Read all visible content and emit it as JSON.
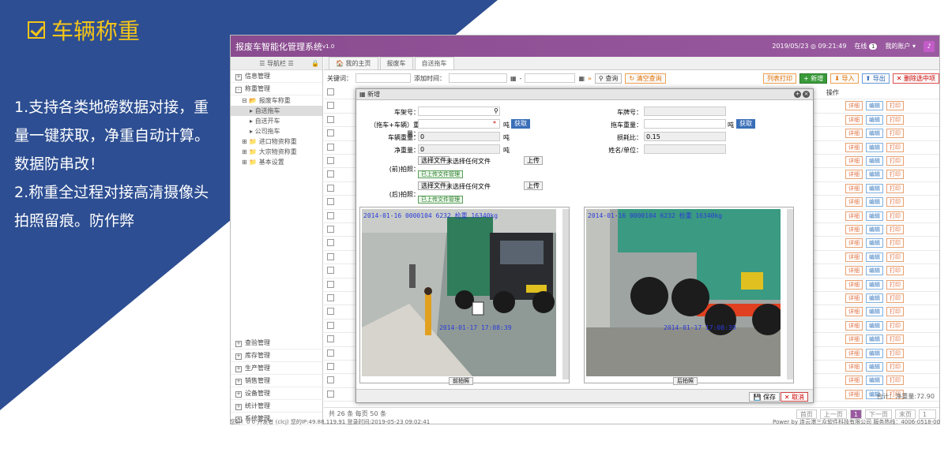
{
  "slide": {
    "title": "车辆称重",
    "body1": "1.支持各类地磅数据对接，重量一键获取，净重自动计算。数据防串改！",
    "body2": "2.称重全过程对接高清摄像头拍照留痕。防作弊"
  },
  "app": {
    "title": "报废车智能化管理系统",
    "version": "v1.0",
    "datetime": "2019/05/23 ◎ 09:21:49",
    "online_label": "在线",
    "online_count": "1",
    "account": "我的账户 ▾"
  },
  "sidebar": {
    "header": "☰ 导航栏 ☰",
    "items": [
      "信息管理",
      "称重管理"
    ],
    "tree_root": "报废车称重",
    "tree_children": [
      "自送拖车",
      "自送开车",
      "公司拖车"
    ],
    "groups": [
      "进口物资称重",
      "大宗物资称重",
      "基本设置"
    ],
    "bottom": [
      "查验管理",
      "库存管理",
      "生产管理",
      "销售管理",
      "设备管理",
      "统计管理",
      "系统管理"
    ]
  },
  "tabs": [
    "我的主页",
    "报废车",
    "自送拖车"
  ],
  "search": {
    "keyword_label": "关键词：",
    "time_label": "添加时间：",
    "query": "查询",
    "clear": "清空查询"
  },
  "toolbar": {
    "print_list": "列表打印",
    "add": "+ 新增",
    "import": "导入",
    "export": "导出",
    "delete": "✕ 删除选中项"
  },
  "grid": {
    "op_header": "操作",
    "detail": "详细",
    "edit": "编辑",
    "print": "打印"
  },
  "footer": {
    "count": "共 26 条 每页 50 条",
    "first": "首页",
    "prev": "上一页",
    "page": "1",
    "next": "下一页",
    "last": "末页",
    "jump": "1",
    "sum": "合计：净重量:72.90"
  },
  "status": {
    "left": "您好！0 0 开发者 (clcj) 您的IP:49.88.119.91 登录时间:2019-05-23 09:02:41",
    "right": "Power by 连云港三众软件科技有限公司 服务热线：4006-0518-00"
  },
  "modal": {
    "title": "新增",
    "frame_no": "车架号：",
    "plate_no": "车牌号：",
    "gross_label": "（拖车+车辆）重量：",
    "tow_label": "拖车重量：",
    "unit": "吨",
    "get": "获取",
    "vehicle_weight_label": "车辆重量：",
    "vehicle_weight": "0",
    "deduct_label": "损耗比：",
    "deduct": "0.15",
    "net_label": "净重量：",
    "net": "0",
    "name_label": "姓名/单位：",
    "front_label": "(前)拍照：",
    "rear_label": "(后)拍照：",
    "choose": "选择文件",
    "no_file": "未选择任何文件",
    "upload": "上传",
    "uploaded": "已上传文件管理",
    "capture_front": "前拍照",
    "capture_rear": "后拍照",
    "ts1": "2014-01-16  0000104 6232 检重 16340kg",
    "ts2": "2014-01-17 17:08:39",
    "ts3": "2014-01-16  0000104 6232 检重 16340kg",
    "ts4": "2014-01-17 17:08:39",
    "save": "保存",
    "cancel": "取消"
  }
}
